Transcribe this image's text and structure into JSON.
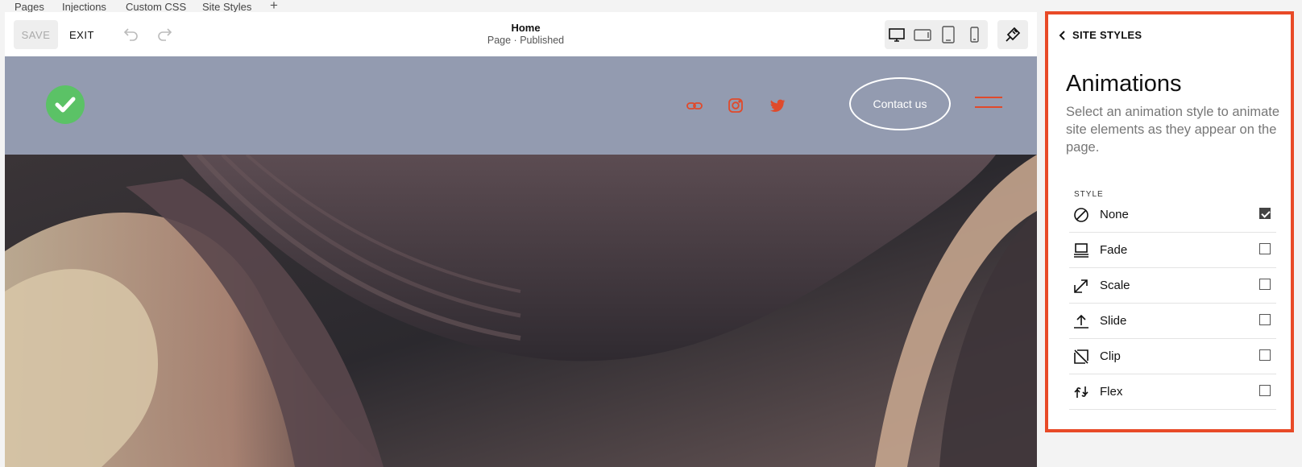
{
  "top_tabs": [
    "Pages",
    "Injections",
    "Custom CSS",
    "Site Styles"
  ],
  "toolbar": {
    "save_label": "SAVE",
    "exit_label": "EXIT",
    "page_title": "Home",
    "page_status": "Page · Published",
    "selected_device": "desktop"
  },
  "site": {
    "contact_label": "Contact us",
    "social_icons": [
      "link-icon",
      "instagram-icon",
      "twitter-icon"
    ],
    "accent_color": "#e04a2b",
    "header_bg": "#939bb0",
    "logo_color": "#5bc266"
  },
  "panel": {
    "back_label": "SITE STYLES",
    "title": "Animations",
    "description": "Select an animation style to animate site elements as they appear on the page.",
    "section_label": "STYLE",
    "highlight_color": "#e84a27",
    "options": [
      {
        "label": "None",
        "icon": "none-icon",
        "checked": true
      },
      {
        "label": "Fade",
        "icon": "fade-icon",
        "checked": false
      },
      {
        "label": "Scale",
        "icon": "scale-icon",
        "checked": false
      },
      {
        "label": "Slide",
        "icon": "slide-icon",
        "checked": false
      },
      {
        "label": "Clip",
        "icon": "clip-icon",
        "checked": false
      },
      {
        "label": "Flex",
        "icon": "flex-icon",
        "checked": false
      }
    ]
  }
}
